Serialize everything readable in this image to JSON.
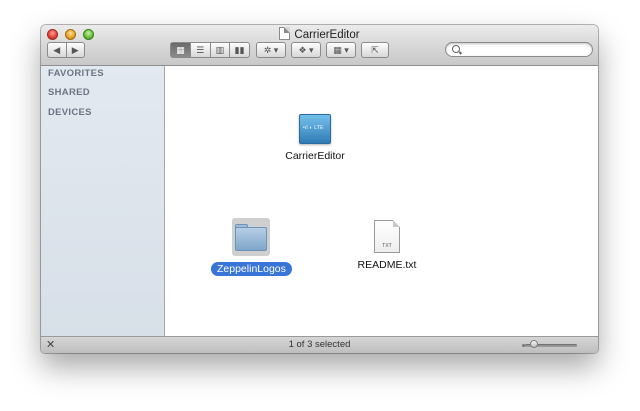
{
  "window": {
    "title": "CarrierEditor"
  },
  "toolbar": {
    "back_icon": "back-arrow-icon",
    "forward_icon": "forward-arrow-icon",
    "view_icons": [
      "icon-view-icon",
      "list-view-icon",
      "column-view-icon",
      "coverflow-view-icon"
    ],
    "action_icon": "gear-icon",
    "dropbox_icon": "dropbox-icon",
    "arrange_icon": "arrange-grid-icon",
    "share_icon": "share-icon",
    "search": {
      "placeholder": "",
      "value": ""
    }
  },
  "sidebar": {
    "sections": [
      "FAVORITES",
      "SHARED",
      "DEVICES"
    ]
  },
  "content": {
    "items": [
      {
        "label": "CarrierEditor",
        "kind": "app",
        "icon_text": "•ıl ◐ LTE"
      },
      {
        "label": "ZeppelinLogos",
        "kind": "folder",
        "selected": true
      },
      {
        "label": "README.txt",
        "kind": "text-file",
        "icon_text": "TXT"
      }
    ]
  },
  "statusbar": {
    "text": "1 of 3 selected"
  },
  "colors": {
    "selection": "#3875d7",
    "sidebar": "#dde4ec"
  }
}
